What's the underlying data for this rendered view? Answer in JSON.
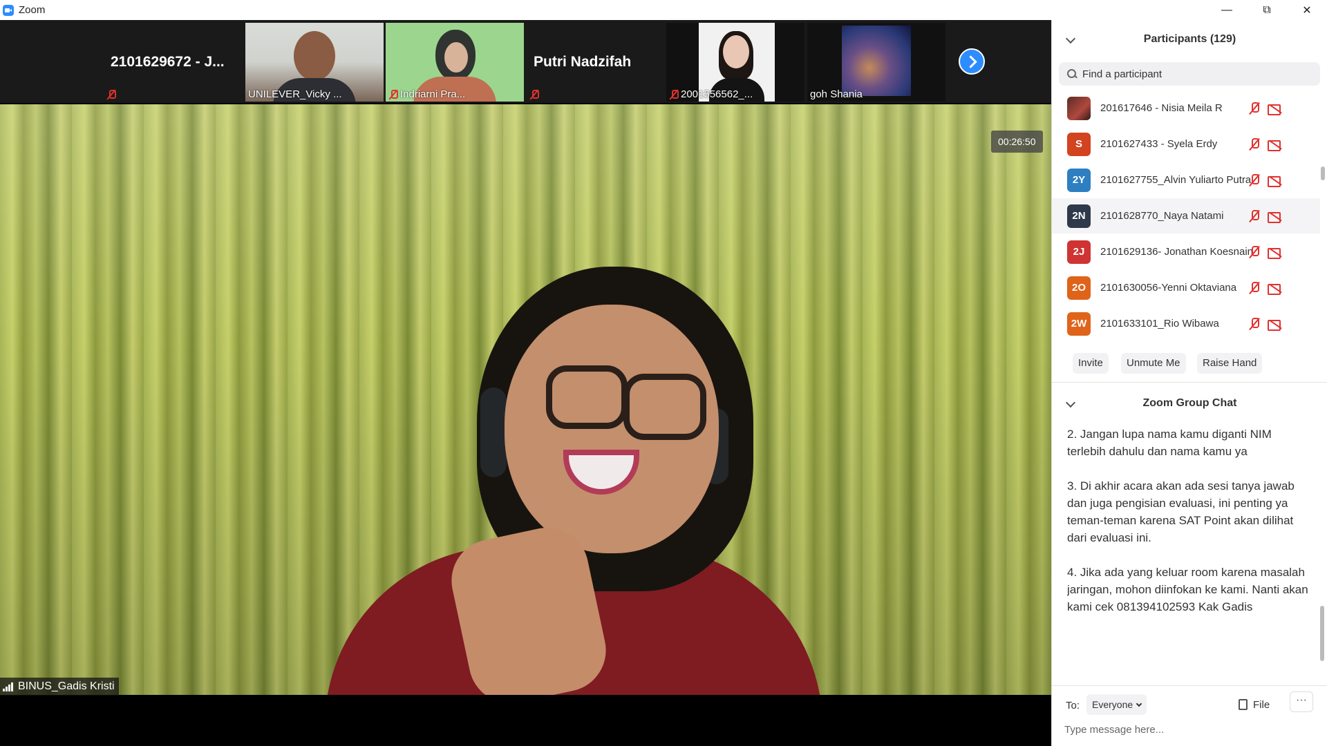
{
  "window": {
    "title": "Zoom",
    "icons": [
      "zoom-logo-icon",
      "minimize-icon",
      "restore-icon",
      "close-icon"
    ]
  },
  "thumbnails": [
    {
      "name": "2101629672 - J...",
      "muted": true,
      "video": false
    },
    {
      "name": "UNILEVER_Vicky ...",
      "muted": false,
      "video": true
    },
    {
      "name": "Indriarni Pra...",
      "muted": true,
      "video": true
    },
    {
      "name": "Putri Nadzifah",
      "muted": true,
      "video": false
    },
    {
      "name": "2001556562_...",
      "muted": true,
      "video": true
    },
    {
      "name": "goh Shania",
      "muted": false,
      "video": true
    }
  ],
  "main_video": {
    "timer": "00:26:50",
    "speaker_name": "BINUS_Gadis Kristi"
  },
  "participants": {
    "header": "Participants (129)",
    "search_placeholder": "Find a participant",
    "list": [
      {
        "initials": "",
        "name": "201617646 - Nisia Meila R",
        "color": "#7a2e28",
        "photo": true
      },
      {
        "initials": "S",
        "name": "2101627433 - Syela Erdy",
        "color": "#d2431f"
      },
      {
        "initials": "2Y",
        "name": "2101627755_Alvin Yuliarto Putra",
        "color": "#2d7fc1"
      },
      {
        "initials": "2N",
        "name": "2101628770_Naya Natami",
        "color": "#2e3a4a"
      },
      {
        "initials": "2J",
        "name": "2101629136- Jonathan Koesnain",
        "color": "#cf3333"
      },
      {
        "initials": "2O",
        "name": "2101630056-Yenni Oktaviana",
        "color": "#e0631a"
      },
      {
        "initials": "2W",
        "name": "2101633101_Rio Wibawa",
        "color": "#e0631a"
      }
    ],
    "buttons": {
      "invite": "Invite",
      "unmute": "Unmute Me",
      "raise_hand": "Raise Hand"
    }
  },
  "chat": {
    "header": "Zoom Group Chat",
    "messages": [
      "2. Jangan lupa nama kamu diganti NIM terlebih dahulu dan nama kamu ya",
      "3. Di akhir acara akan ada sesi tanya jawab dan juga pengisian evaluasi, ini penting ya teman-teman karena SAT Point akan dilihat dari evaluasi ini.",
      "4. Jika ada yang keluar room karena masalah jaringan, mohon diinfokan ke kami. Nanti akan kami cek 081394102593 Kak Gadis"
    ],
    "to_label": "To:",
    "recipient": "Everyone",
    "file_label": "File",
    "more_label": "···",
    "input_placeholder": "Type message here..."
  },
  "colors": {
    "accent": "#2D8CFF",
    "muted_red": "#e0312e",
    "panel_bg": "#ffffff",
    "strip_bg": "#1a1a1a"
  }
}
